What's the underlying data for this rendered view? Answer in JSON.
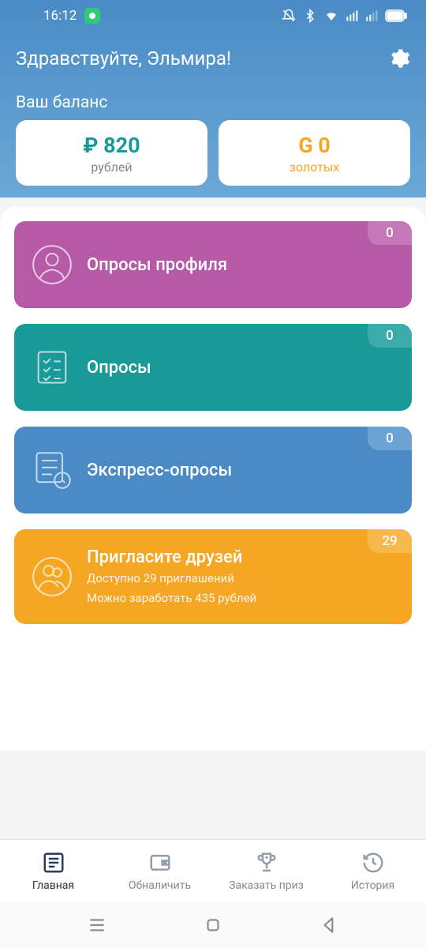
{
  "status": {
    "time": "16:12"
  },
  "header": {
    "greeting": "Здравствуйте, Эльмира!",
    "balance_label": "Ваш баланс",
    "rubles": {
      "amount": "₽ 820",
      "label": "рублей"
    },
    "gold": {
      "amount": "G 0",
      "label": "золотых"
    }
  },
  "cards": {
    "profile_surveys": {
      "title": "Опросы профиля",
      "badge": "0"
    },
    "surveys": {
      "title": "Опросы",
      "badge": "0"
    },
    "express": {
      "title": "Экспресс-опросы",
      "badge": "0"
    },
    "invite": {
      "title": "Пригласите друзей",
      "sub1": "Доступно 29 приглашений",
      "sub2": "Можно заработать 435 рублей",
      "badge": "29"
    }
  },
  "nav": {
    "home": "Главная",
    "cashout": "Обналичить",
    "prize": "Заказать приз",
    "history": "История"
  }
}
